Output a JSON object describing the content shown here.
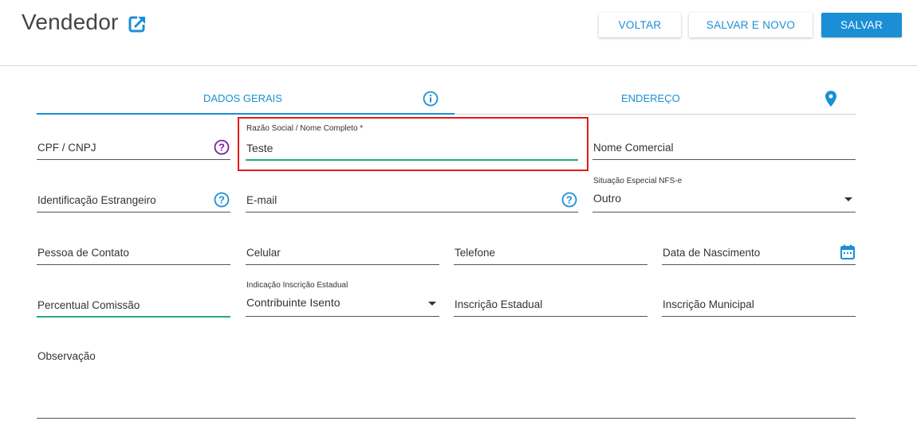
{
  "header": {
    "title": "Vendedor",
    "buttons": {
      "back": "VOLTAR",
      "save_new": "SALVAR E NOVO",
      "save": "SALVAR"
    }
  },
  "tabs": [
    {
      "label": "DADOS GERAIS",
      "icon": "info-icon",
      "active": true
    },
    {
      "label": "ENDEREÇO",
      "icon": "location-pin-icon",
      "active": false
    }
  ],
  "form": {
    "cpf_cnpj": {
      "label": "CPF / CNPJ"
    },
    "razao_social": {
      "label": "Razão Social / Nome Completo *",
      "value": "Teste"
    },
    "nome_comercial": {
      "label": "Nome Comercial"
    },
    "identificacao_estrangeiro": {
      "label": "Identificação Estrangeiro"
    },
    "email": {
      "label": "E-mail"
    },
    "situacao_especial": {
      "label": "Situação Especial NFS-e",
      "value": "Outro"
    },
    "pessoa_contato": {
      "label": "Pessoa de Contato"
    },
    "celular": {
      "label": "Celular"
    },
    "telefone": {
      "label": "Telefone"
    },
    "data_nascimento": {
      "label": "Data de Nascimento"
    },
    "percentual_comissao": {
      "label": "Percentual Comissão"
    },
    "indicacao_ie": {
      "label": "Indicação Inscrição Estadual",
      "value": "Contribuinte Isento"
    },
    "inscricao_estadual": {
      "label": "Inscrição Estadual"
    },
    "inscricao_municipal": {
      "label": "Inscrição Municipal"
    },
    "observacao": {
      "label": "Observação"
    }
  },
  "colors": {
    "accent": "#1a8fd6",
    "active_underline": "#2aa876",
    "help_purple": "#7b1fa2",
    "highlight": "#e01b1b"
  }
}
